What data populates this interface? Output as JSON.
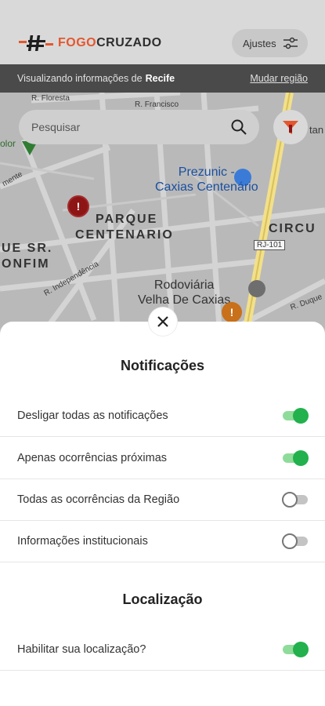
{
  "header": {
    "logo_fogo": "FOGO",
    "logo_cruzado": "CRUZADO",
    "settings_label": "Ajustes"
  },
  "region_bar": {
    "prefix": "Visualizando informações de",
    "region": "Recife",
    "change_link": "Mudar região"
  },
  "map": {
    "search_placeholder": "Pesquisar",
    "labels": {
      "street_floresta": "R. Floresta",
      "street_francisco": "R. Francisco",
      "street_independencia": "R. Independência",
      "street_duque": "R. Duque",
      "street_mente": "mente",
      "lolor": "olor",
      "tan": "tan",
      "parque_1": "PARQUE",
      "parque_2": "CENTENARIO",
      "senhor_1": "UE SR.",
      "senhor_2": "ONFIM",
      "circu": "CIRCU",
      "rj101": "RJ-101",
      "prezunic_1": "Prezunic -",
      "prezunic_2": "Caxias Centenário",
      "rodoviaria_1": "Rodoviária",
      "rodoviaria_2": "Velha De Caxias",
      "pin_mark": "!"
    }
  },
  "notifications": {
    "title": "Notificações",
    "items": [
      {
        "label": "Desligar todas as notificações",
        "on": true
      },
      {
        "label": "Apenas ocorrências próximas",
        "on": true
      },
      {
        "label": "Todas as ocorrências da Região",
        "on": false
      },
      {
        "label": "Informações institucionais",
        "on": false
      }
    ]
  },
  "location": {
    "title": "Localização",
    "items": [
      {
        "label": "Habilitar sua localização?",
        "on": true
      }
    ]
  },
  "colors": {
    "accent": "#e4572e",
    "toggle_on": "#22b14c",
    "region_bar": "#4a4a4a"
  }
}
